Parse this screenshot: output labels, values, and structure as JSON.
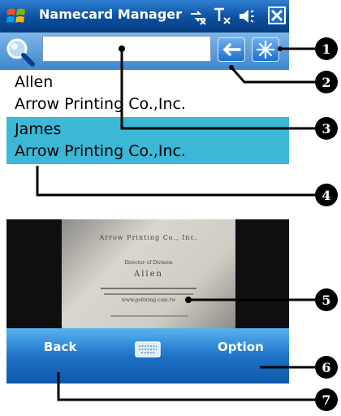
{
  "titlebar": {
    "app_title": "Namecard Manager",
    "icons": [
      "windows-logo-icon",
      "connectivity-icon",
      "signal-off-icon",
      "volume-icon",
      "close-icon"
    ]
  },
  "search": {
    "value": "",
    "icons": [
      "magnifier-icon",
      "backspace-arrow-icon",
      "capture-icon"
    ]
  },
  "list": {
    "items": [
      {
        "name": "Allen",
        "company": "Arrow Printing Co.,Inc.",
        "selected": false
      },
      {
        "name": "James",
        "company": "Arrow Printing Co.,Inc.",
        "selected": true
      }
    ],
    "selected_color": "#3cb7d6"
  },
  "preview": {
    "card_lines": [
      "Arrow Printing Co., Inc.",
      "Director of Division",
      "Allen",
      "www.goforing.com.tw"
    ]
  },
  "bottombar": {
    "left_softkey": "Back",
    "right_softkey": "Option",
    "keyboard_icon": "keyboard-icon"
  },
  "callouts": [
    "1",
    "2",
    "3",
    "4",
    "5",
    "6",
    "7"
  ]
}
